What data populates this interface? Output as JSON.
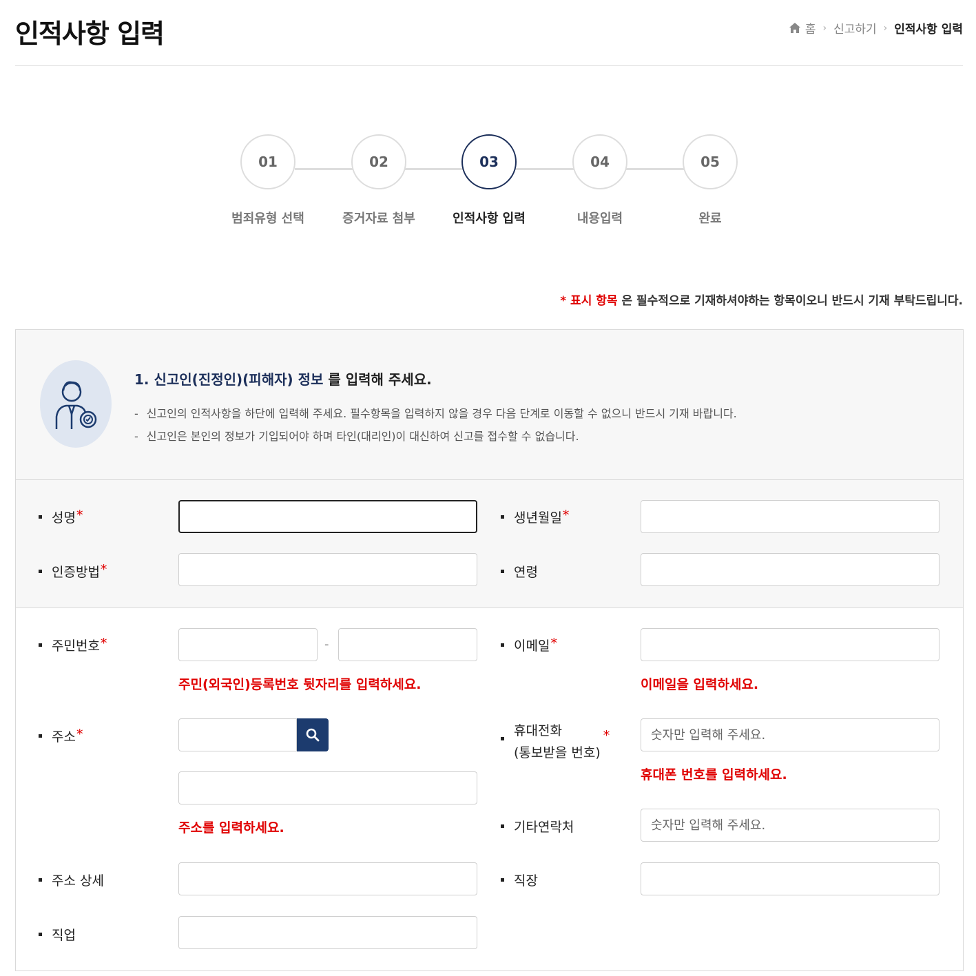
{
  "page_title": "인적사항 입력",
  "breadcrumb": {
    "home": "홈",
    "level1": "신고하기",
    "current": "인적사항 입력"
  },
  "steps": [
    {
      "num": "01",
      "label": "범죄유형 선택"
    },
    {
      "num": "02",
      "label": "증거자료 첨부"
    },
    {
      "num": "03",
      "label": "인적사항 입력",
      "active": true
    },
    {
      "num": "04",
      "label": "내용입력"
    },
    {
      "num": "05",
      "label": "완료"
    }
  ],
  "required_note": {
    "marker": "* 표시 항목",
    "text": " 은 필수적으로 기재하셔야하는 항목이오니 반드시 기재 부탁드립니다."
  },
  "info": {
    "title_highlight": "1. 신고인(진정인)(피해자) 정보",
    "title_rest": " 를 입력해 주세요.",
    "line1": "신고인의 인적사항을 하단에 입력해 주세요. 필수항목을 입력하지 않을 경우 다음 단계로 이동할 수 없으니 반드시 기재 바랍니다.",
    "line2": "신고인은 본인의 정보가 기입되어야 하며 타인(대리인)이 대신하여 신고를 접수할 수 없습니다.",
    "dash": "-"
  },
  "fields": {
    "name": {
      "label": "성명",
      "star": "*"
    },
    "birth": {
      "label": "생년월일",
      "star": "*"
    },
    "auth": {
      "label": "인증방법",
      "star": "*"
    },
    "age": {
      "label": "연령"
    },
    "rrn": {
      "label": "주민번호",
      "star": "*",
      "separator": "-",
      "error": "주민(외국인)등록번호 뒷자리를 입력하세요."
    },
    "email": {
      "label": "이메일",
      "star": "*",
      "error": "이메일을 입력하세요."
    },
    "address": {
      "label": "주소",
      "star": "*",
      "error": "주소를 입력하세요."
    },
    "mobile": {
      "label_line1": "휴대전화",
      "label_line2": "(통보받을 번호)",
      "star": "*",
      "placeholder": "숫자만 입력해 주세요.",
      "error": "휴대폰 번호를 입력하세요."
    },
    "other_contact": {
      "label": "기타연락처",
      "placeholder": "숫자만 입력해 주세요."
    },
    "address_detail": {
      "label": "주소 상세"
    },
    "workplace": {
      "label": "직장"
    },
    "occupation": {
      "label": "직업"
    }
  },
  "colors": {
    "accent": "#1c3b6e",
    "error": "#e00000",
    "panel": "#f7f7f7"
  }
}
